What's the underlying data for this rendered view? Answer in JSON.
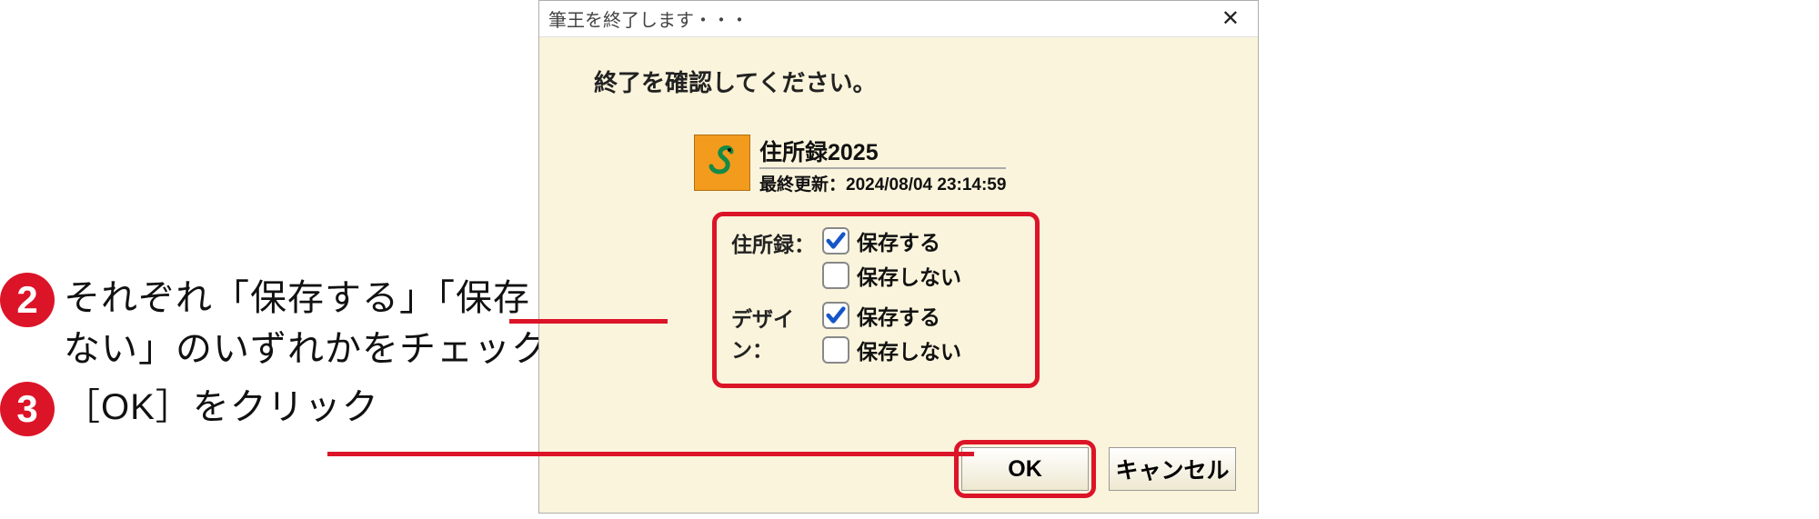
{
  "instructions": {
    "step2": {
      "badge": "2",
      "text": "それぞれ「保存する」「保存し\nない」のいずれかをチェック"
    },
    "step3": {
      "badge": "3",
      "text": "［OK］をクリック"
    }
  },
  "dialog": {
    "title": "筆王を終了します・・・",
    "confirm_label": "終了を確認してください。",
    "file": {
      "name": "住所録2025",
      "meta_label": "最終更新：",
      "meta_value": "2024/08/04 23:14:59"
    },
    "groups": [
      {
        "label": "住所録：",
        "choices": [
          {
            "label": "保存する",
            "checked": true
          },
          {
            "label": "保存しない",
            "checked": false
          }
        ]
      },
      {
        "label": "デザイン：",
        "choices": [
          {
            "label": "保存する",
            "checked": true
          },
          {
            "label": "保存しない",
            "checked": false
          }
        ]
      }
    ],
    "buttons": {
      "ok": "OK",
      "cancel": "キャンセル"
    }
  }
}
